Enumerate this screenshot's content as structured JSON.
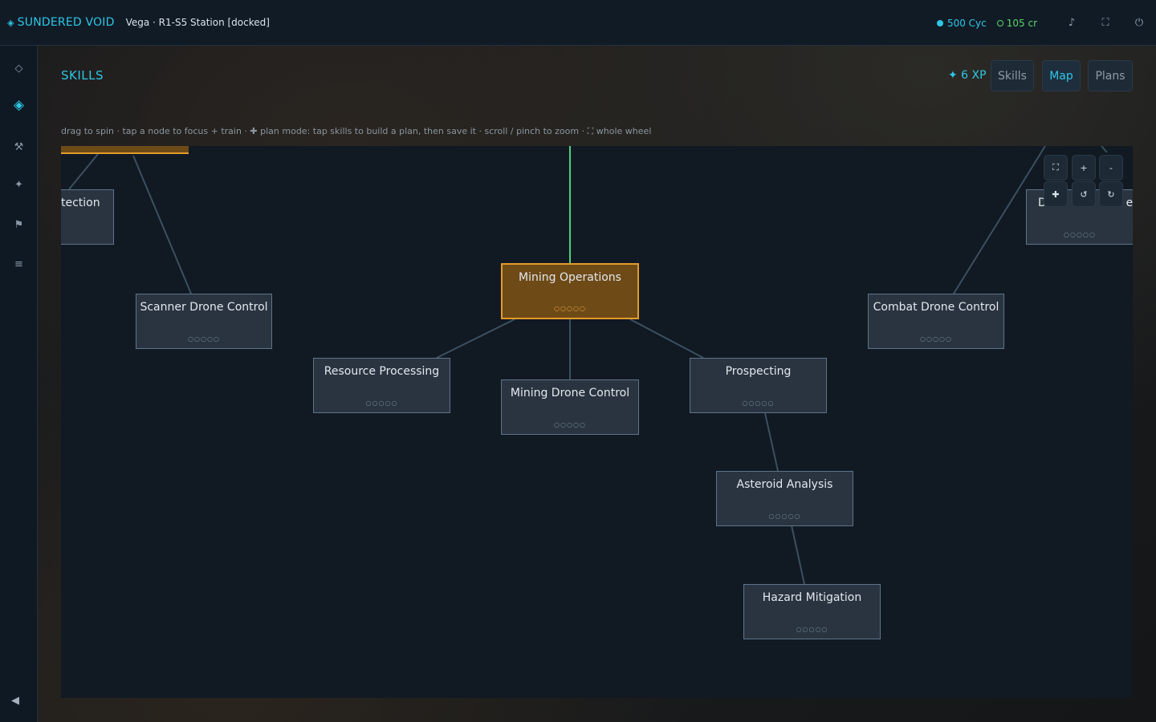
{
  "topbar": {
    "brand_icon": "diamond-icon",
    "brand": "SUNDERED VOID",
    "location": "Vega · R1-S5 Station [docked]",
    "cycles": "500 Cyc",
    "credits": "105 cr",
    "icons": [
      "music-icon",
      "fullscreen-icon",
      "power-icon"
    ]
  },
  "rail": {
    "items": [
      {
        "name": "hub",
        "icon": "diamond-outline-icon",
        "glyph": "◇"
      },
      {
        "name": "skills",
        "icon": "diamond-filled-icon",
        "glyph": "◈",
        "active": true
      },
      {
        "name": "crafting",
        "icon": "tools-icon",
        "glyph": "⚒"
      },
      {
        "name": "stars",
        "icon": "star-icon",
        "glyph": "✦"
      },
      {
        "name": "missions",
        "icon": "flag-icon",
        "glyph": "⚑"
      },
      {
        "name": "menu",
        "icon": "menu-icon",
        "glyph": "≡"
      }
    ],
    "collapse_glyph": "◀"
  },
  "header": {
    "title": "SKILLS",
    "xp": "✦ 6 XP",
    "tabs": [
      {
        "label": "Skills",
        "active": false
      },
      {
        "label": "Map",
        "active": true
      },
      {
        "label": "Plans",
        "active": false
      }
    ],
    "hint": "drag to spin · tap a node to focus + train · ✚ plan mode: tap skills to build a plan, then save it · scroll / pinch to zoom · ⛶ whole wheel"
  },
  "tree": {
    "nodes": [
      {
        "label": "tection",
        "dots": ""
      },
      {
        "label": "Scanner Drone Control",
        "dots": "○○○○○"
      },
      {
        "label": "Mining Operations",
        "dots": "○○○○○",
        "focus": true
      },
      {
        "label": "Resource Processing",
        "dots": "○○○○○"
      },
      {
        "label": "Mining Drone Control",
        "dots": "○○○○○"
      },
      {
        "label": "Prospecting",
        "dots": "○○○○○"
      },
      {
        "label": "Asteroid Analysis",
        "dots": "○○○○○"
      },
      {
        "label": "Hazard Mitigation",
        "dots": "○○○○○"
      },
      {
        "label": "Combat Drone Control",
        "dots": "○○○○○"
      },
      {
        "label": "D",
        "label_end": "er",
        "dots": "○○○○○"
      }
    ],
    "top_stub_dots": "○○○○○",
    "link_color": "#3b5060",
    "active_link_color": "#4fd07a",
    "focus_color": "#e39b2a"
  },
  "zoom_controls": {
    "fit": "⛶",
    "zoom_in": "+",
    "zoom_out": "-",
    "plan": "✚",
    "rotate_left": "↺",
    "rotate_right": "↻"
  }
}
